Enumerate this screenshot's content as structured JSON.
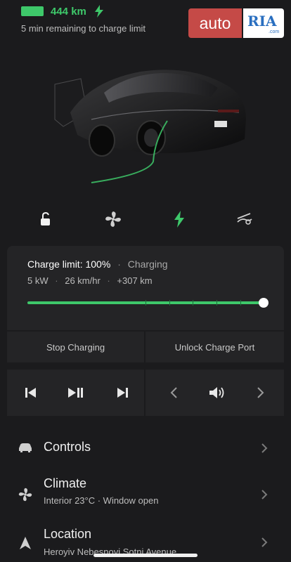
{
  "status": {
    "range": "444 km",
    "remaining": "5 min remaining to charge limit"
  },
  "watermark": {
    "left": "auto",
    "right": "RIA",
    "domain": ".com"
  },
  "quick_controls": [
    {
      "name": "lock-icon"
    },
    {
      "name": "fan-icon"
    },
    {
      "name": "charge-bolt-icon"
    },
    {
      "name": "vent-icon"
    }
  ],
  "charge": {
    "limit_label": "Charge limit:",
    "limit_value": "100%",
    "state": "Charging",
    "power": "5 kW",
    "rate": "26 km/hr",
    "added": "+307 km",
    "limit_fraction": 1.0,
    "colors": {
      "accent": "#3ec86a"
    }
  },
  "actions": {
    "stop": "Stop Charging",
    "unlock": "Unlock Charge Port"
  },
  "menu": [
    {
      "title": "Controls",
      "subtitle": ""
    },
    {
      "title": "Climate",
      "subtitle": "Interior 23°C · Window open"
    },
    {
      "title": "Location",
      "subtitle": "Heroyiv Nebesnoyi Sotni Avenue"
    }
  ]
}
